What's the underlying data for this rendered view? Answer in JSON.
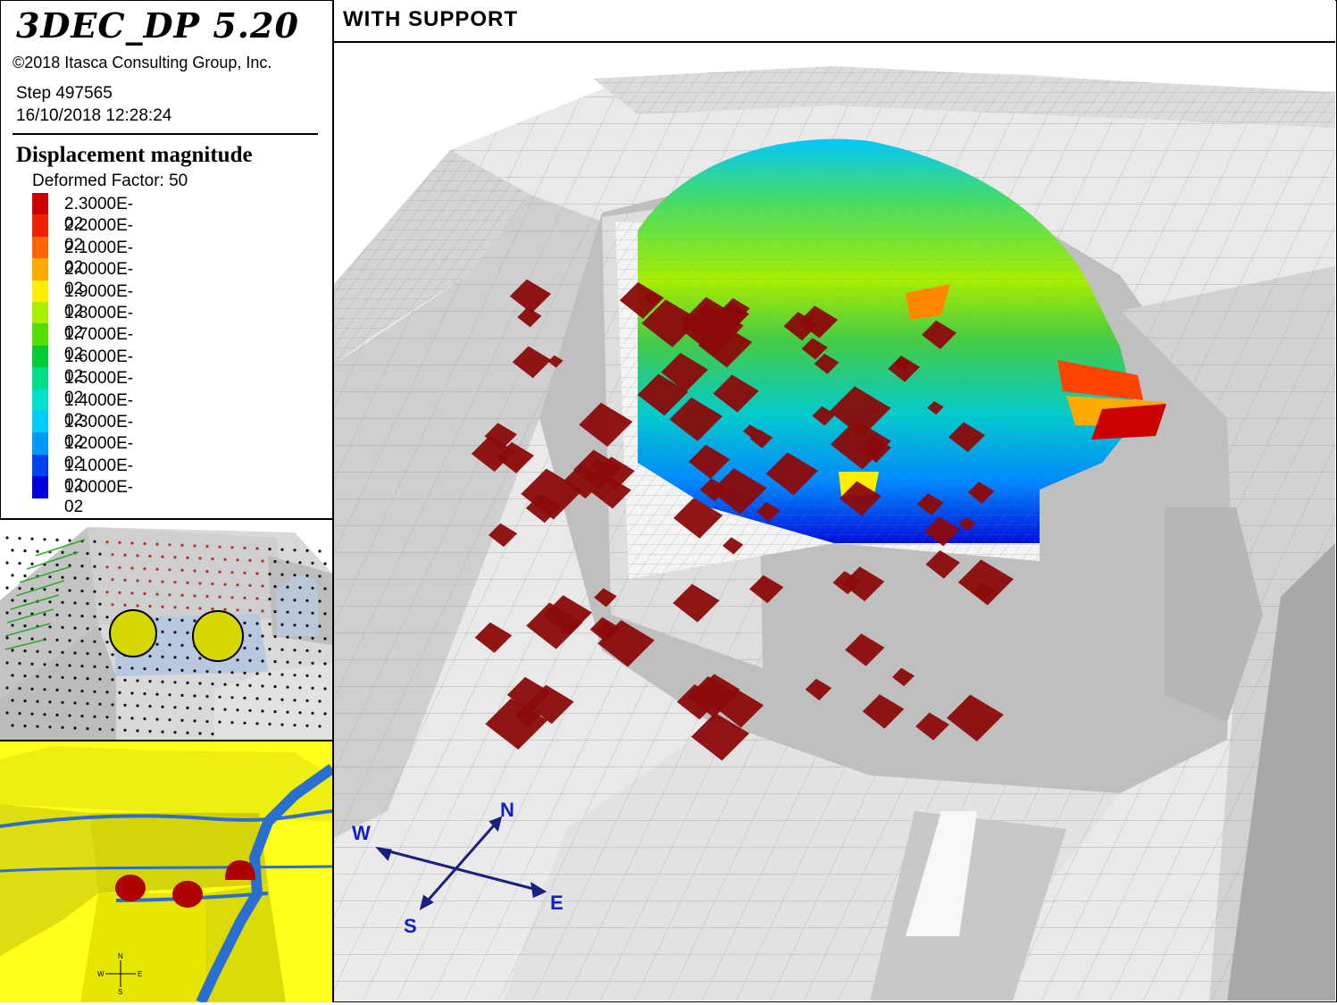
{
  "app": {
    "title": "3DEC_DP 5.20",
    "copyright": "©2018 Itasca Consulting Group, Inc.",
    "step": "Step 497565",
    "datetime": "16/10/2018 12:28:24"
  },
  "legend": {
    "title": "Displacement magnitude",
    "deformed": "Deformed Factor: 50",
    "entries": [
      {
        "label": "2.3000E-02",
        "color": "#cc0000"
      },
      {
        "label": "2.2000E-02",
        "color": "#ee2200"
      },
      {
        "label": "2.1000E-02",
        "color": "#ff6600"
      },
      {
        "label": "2.0000E-02",
        "color": "#ffaa00"
      },
      {
        "label": "1.9000E-02",
        "color": "#ffee00"
      },
      {
        "label": "1.8000E-02",
        "color": "#aaee00"
      },
      {
        "label": "1.7000E-02",
        "color": "#55dd00"
      },
      {
        "label": "1.6000E-02",
        "color": "#00cc33"
      },
      {
        "label": "1.5000E-02",
        "color": "#00dd88"
      },
      {
        "label": "1.4000E-02",
        "color": "#00e0cc"
      },
      {
        "label": "1.3000E-02",
        "color": "#00ccff"
      },
      {
        "label": "1.2000E-02",
        "color": "#0099ff"
      },
      {
        "label": "1.1000E-02",
        "color": "#0044ee"
      },
      {
        "label": "1.0000E-02",
        "color": "#0000dd"
      }
    ]
  },
  "view": {
    "title": "WITH SUPPORT"
  },
  "compass": {
    "north": "N",
    "south": "S",
    "east": "E",
    "west": "W"
  },
  "thumb_compass": {
    "north": "N",
    "south": "S",
    "east": "E",
    "west": "W"
  },
  "colors": {
    "support_red": "#8b0a0a",
    "mesh_gray": "#d8d8d8",
    "compass_blue": "#1a2080",
    "thumb_yellow": "#ffff00",
    "fault_blue": "#2a6fd0"
  }
}
